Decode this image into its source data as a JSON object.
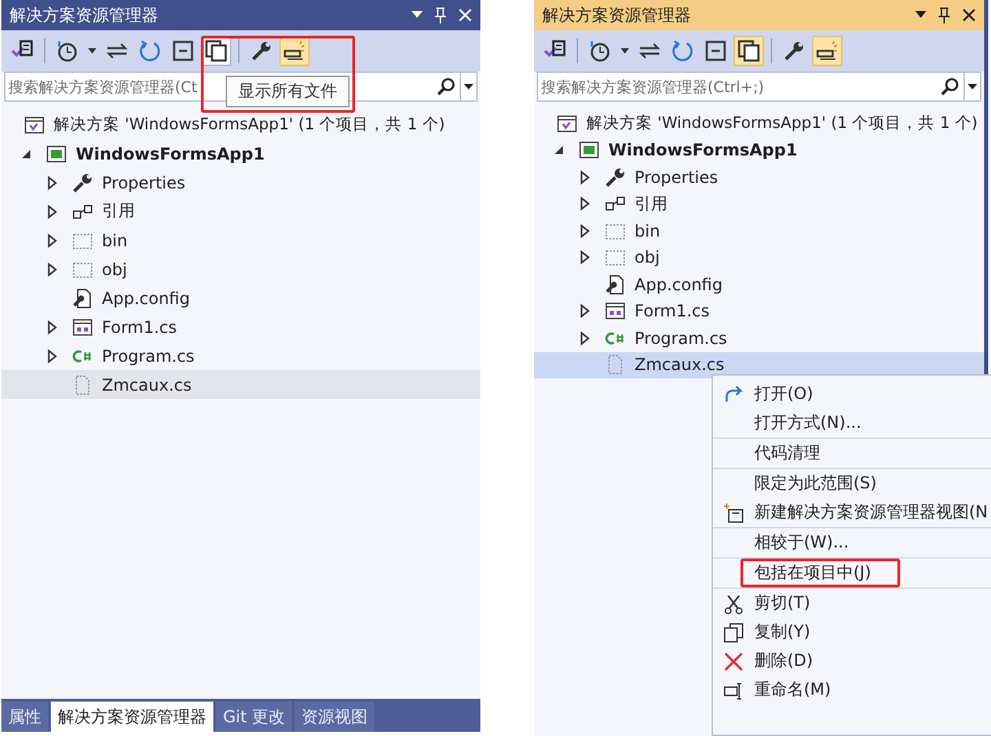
{
  "panels": [
    {
      "active": false,
      "title": "解决方案资源管理器",
      "annotation_box": true,
      "toolbar": [
        {
          "kind": "switch-views",
          "on": false,
          "hovered": false
        },
        {
          "kind": "sep"
        },
        {
          "kind": "history",
          "on": false,
          "hovered": false
        },
        {
          "kind": "caret",
          "on": false,
          "hovered": false
        },
        {
          "kind": "sync",
          "on": false,
          "hovered": false
        },
        {
          "kind": "refresh",
          "on": false,
          "hovered": false
        },
        {
          "kind": "collapse",
          "on": false,
          "hovered": false
        },
        {
          "kind": "show-all",
          "on": false,
          "hovered": true
        },
        {
          "kind": "sep"
        },
        {
          "kind": "wrench",
          "on": false,
          "hovered": false
        },
        {
          "kind": "preview",
          "on": true,
          "hovered": false
        }
      ],
      "tooltip": "显示所有文件",
      "search": {
        "placeholder": "搜索解决方案资源管理器(Ct"
      },
      "tree": [
        {
          "label": "解决方案 'WindowsFormsApp1' (1 个项目，共 1 个)",
          "kind": "solution",
          "selected": false,
          "children": [
            {
              "label": "WindowsFormsApp1",
              "kind": "project",
              "expanded": true,
              "selected": false,
              "children": [
                {
                  "label": "Properties",
                  "kind": "wrench",
                  "expanded": false,
                  "selected": false
                },
                {
                  "label": "引用",
                  "kind": "references",
                  "expanded": false,
                  "selected": false
                },
                {
                  "label": "bin",
                  "kind": "hidden-folder",
                  "expanded": false,
                  "selected": false
                },
                {
                  "label": "obj",
                  "kind": "hidden-folder",
                  "expanded": false,
                  "selected": false
                },
                {
                  "label": "App.config",
                  "kind": "config",
                  "selected": false
                },
                {
                  "label": "Form1.cs",
                  "kind": "form",
                  "expanded": false,
                  "selected": false
                },
                {
                  "label": "Program.cs",
                  "kind": "csharp",
                  "expanded": false,
                  "selected": false
                },
                {
                  "label": "Zmcaux.cs",
                  "kind": "hidden-file",
                  "selected": true
                }
              ]
            }
          ]
        }
      ],
      "tabs": [
        {
          "label": "属性",
          "selected": false
        },
        {
          "label": "解决方案资源管理器",
          "selected": true
        },
        {
          "label": "Git 更改",
          "selected": false
        },
        {
          "label": "资源视图",
          "selected": false
        }
      ]
    },
    {
      "active": true,
      "title": "解决方案资源管理器",
      "annotation_box": false,
      "toolbar": [
        {
          "kind": "switch-views",
          "on": false,
          "hovered": false
        },
        {
          "kind": "sep"
        },
        {
          "kind": "history",
          "on": false,
          "hovered": false
        },
        {
          "kind": "caret",
          "on": false,
          "hovered": false
        },
        {
          "kind": "sync",
          "on": false,
          "hovered": false
        },
        {
          "kind": "refresh",
          "on": false,
          "hovered": false
        },
        {
          "kind": "collapse",
          "on": false,
          "hovered": false
        },
        {
          "kind": "show-all",
          "on": true,
          "hovered": false
        },
        {
          "kind": "sep"
        },
        {
          "kind": "wrench",
          "on": false,
          "hovered": false
        },
        {
          "kind": "preview",
          "on": true,
          "hovered": false
        }
      ],
      "search": {
        "placeholder": "搜索解决方案资源管理器(Ctrl+;)"
      },
      "tree": [
        {
          "label": "解决方案 'WindowsFormsApp1' (1 个项目，共 1 个)",
          "kind": "solution",
          "selected": false,
          "children": [
            {
              "label": "WindowsFormsApp1",
              "kind": "project",
              "expanded": true,
              "selected": false,
              "children": [
                {
                  "label": "Properties",
                  "kind": "wrench",
                  "expanded": false,
                  "selected": false
                },
                {
                  "label": "引用",
                  "kind": "references",
                  "expanded": false,
                  "selected": false
                },
                {
                  "label": "bin",
                  "kind": "hidden-folder",
                  "expanded": false,
                  "selected": false
                },
                {
                  "label": "obj",
                  "kind": "hidden-folder",
                  "expanded": false,
                  "selected": false
                },
                {
                  "label": "App.config",
                  "kind": "config",
                  "selected": false
                },
                {
                  "label": "Form1.cs",
                  "kind": "form",
                  "expanded": false,
                  "selected": false
                },
                {
                  "label": "Program.cs",
                  "kind": "csharp",
                  "expanded": false,
                  "selected": false
                },
                {
                  "label": "Zmcaux.cs",
                  "kind": "hidden-file",
                  "selected": true
                }
              ]
            }
          ]
        }
      ]
    }
  ],
  "context_menu": [
    {
      "label": "打开(O)",
      "kind": "open",
      "separator_after": false,
      "annotated": false
    },
    {
      "label": "打开方式(N)...",
      "kind": "plain",
      "separator_after": true,
      "annotated": false
    },
    {
      "label": "代码清理",
      "kind": "plain",
      "separator_after": true,
      "annotated": false
    },
    {
      "label": "限定为此范围(S)",
      "kind": "plain",
      "separator_after": false,
      "annotated": false
    },
    {
      "label": "新建解决方案资源管理器视图(N",
      "kind": "new-view",
      "separator_after": true,
      "annotated": false
    },
    {
      "label": "相较于(W)...",
      "kind": "plain",
      "separator_after": true,
      "annotated": false
    },
    {
      "label": "包括在项目中(J)",
      "kind": "plain",
      "separator_after": true,
      "annotated": true
    },
    {
      "label": "剪切(T)",
      "kind": "cut",
      "separator_after": false,
      "annotated": false
    },
    {
      "label": "复制(Y)",
      "kind": "copy",
      "separator_after": false,
      "annotated": false
    },
    {
      "label": "删除(D)",
      "kind": "delete",
      "separator_after": false,
      "annotated": false
    },
    {
      "label": "重命名(M)",
      "kind": "rename",
      "separator_after": false,
      "annotated": false
    }
  ]
}
